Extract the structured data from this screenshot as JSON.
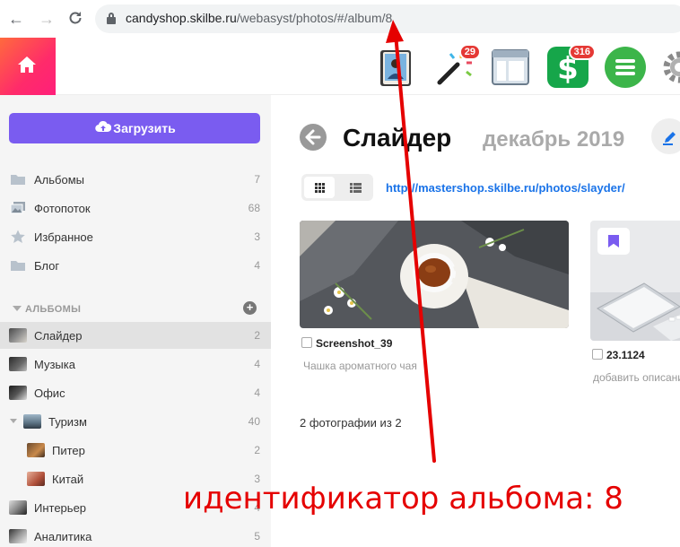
{
  "browser": {
    "url_host": "candyshop.skilbe.ru",
    "url_path": "/webasyst/photos/#/album/8"
  },
  "header": {
    "apps": [
      {
        "name": "contacts",
        "badge": ""
      },
      {
        "name": "site",
        "badge": "29"
      },
      {
        "name": "installer",
        "badge": ""
      },
      {
        "name": "shop",
        "badge": "316"
      },
      {
        "name": "menu",
        "badge": ""
      },
      {
        "name": "settings",
        "badge": ""
      }
    ]
  },
  "sidebar": {
    "upload_label": "Загрузить",
    "nav": [
      {
        "label": "Альбомы",
        "count": "7",
        "icon": "folder-icon"
      },
      {
        "label": "Фотопоток",
        "count": "68",
        "icon": "photostream-icon"
      },
      {
        "label": "Избранное",
        "count": "3",
        "icon": "star-icon"
      },
      {
        "label": "Блог",
        "count": "4",
        "icon": "folder-icon"
      }
    ],
    "albums_heading": "АЛЬБОМЫ",
    "albums": [
      {
        "label": "Слайдер",
        "count": "2",
        "active": true
      },
      {
        "label": "Музыка",
        "count": "4"
      },
      {
        "label": "Офис",
        "count": "4"
      },
      {
        "label": "Туризм",
        "count": "40"
      },
      {
        "label": "Питер",
        "count": "2"
      },
      {
        "label": "Китай",
        "count": "3"
      },
      {
        "label": "Интерьер",
        "count": "4"
      },
      {
        "label": "Аналитика",
        "count": "5"
      }
    ]
  },
  "main": {
    "title": "Слайдер",
    "date": "декабрь 2019",
    "album_url": "http://mastershop.skilbe.ru/photos/slayder/",
    "photos": [
      {
        "name": "Screenshot_39",
        "description": "Чашка ароматного чая"
      },
      {
        "name": "23.1124",
        "description": "добавить описание"
      }
    ],
    "photo_count": "2 фотографии из 2"
  },
  "annotation": {
    "text": "идентификатор альбома: 8",
    "color": "#e50000"
  },
  "colors": {
    "accent": "#7a5cf0",
    "link": "#1a73e8",
    "home_gradient_start": "#ff6a3d",
    "home_gradient_end": "#ff1f7a"
  }
}
